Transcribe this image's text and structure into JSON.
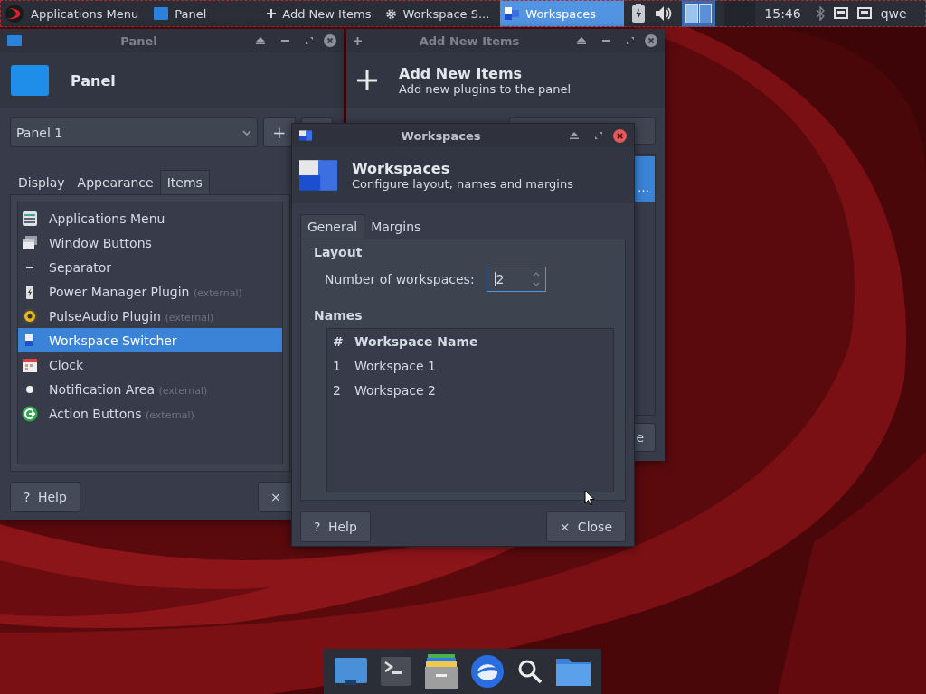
{
  "top_panel": {
    "items": [
      {
        "kind": "app_menu",
        "label": "Applications Menu",
        "selected": false
      },
      {
        "kind": "panel",
        "label": "Panel",
        "selected": false
      },
      {
        "kind": "add",
        "label": "Add New Items",
        "selected": false
      },
      {
        "kind": "gear",
        "label": "Workspace S...",
        "selected": false
      },
      {
        "kind": "workspaces",
        "label": "Workspaces",
        "selected": true
      }
    ],
    "clock": "15:46",
    "user": "qwe"
  },
  "panel_window": {
    "title": "Panel",
    "heading": "Panel",
    "dropdown": "Panel 1",
    "add_button": "+",
    "tabs": [
      {
        "label": "Display",
        "selected": false
      },
      {
        "label": "Appearance",
        "selected": false
      },
      {
        "label": "Items",
        "selected": true
      }
    ],
    "items": [
      {
        "kind": "menu",
        "label": "Applications Menu",
        "selected": false
      },
      {
        "kind": "windows",
        "label": "Window Buttons",
        "selected": false
      },
      {
        "kind": "separator",
        "label": "Separator",
        "selected": false
      },
      {
        "kind": "battery",
        "label": "Power Manager Plugin",
        "note": "(external)",
        "selected": false
      },
      {
        "kind": "audio",
        "label": "PulseAudio Plugin",
        "note": "(external)",
        "selected": false
      },
      {
        "kind": "workspace",
        "label": "Workspace Switcher",
        "selected": true
      },
      {
        "kind": "clock",
        "label": "Clock",
        "selected": false
      },
      {
        "kind": "notification",
        "label": "Notification Area",
        "note": "(external)",
        "selected": false
      },
      {
        "kind": "action",
        "label": "Action Buttons",
        "note": "(external)",
        "selected": false
      }
    ],
    "help_button": {
      "glyph": "?",
      "label": "Help"
    },
    "close_button": {
      "glyph": "×"
    }
  },
  "add_items_window": {
    "title": "Add New Items",
    "heading": "Add New Items",
    "subheading": "Add new plugins to the panel",
    "selected_row": "…",
    "button": "e"
  },
  "workspaces_dialog": {
    "title": "Workspaces",
    "heading": "Workspaces",
    "subheading": "Configure layout, names and margins",
    "tabs": [
      {
        "label": "General",
        "selected": true
      },
      {
        "label": "Margins",
        "selected": false
      }
    ],
    "layout_label": "Layout",
    "count_label": "Number of workspaces:",
    "count_value": "2",
    "names_label": "Names",
    "columns": [
      "#",
      "Workspace Name"
    ],
    "rows": [
      [
        "1",
        "Workspace 1"
      ],
      [
        "2",
        "Workspace 2"
      ]
    ],
    "help_button": {
      "glyph": "?",
      "label": "Help"
    },
    "close_button": {
      "glyph": "×",
      "label": "Close"
    }
  }
}
